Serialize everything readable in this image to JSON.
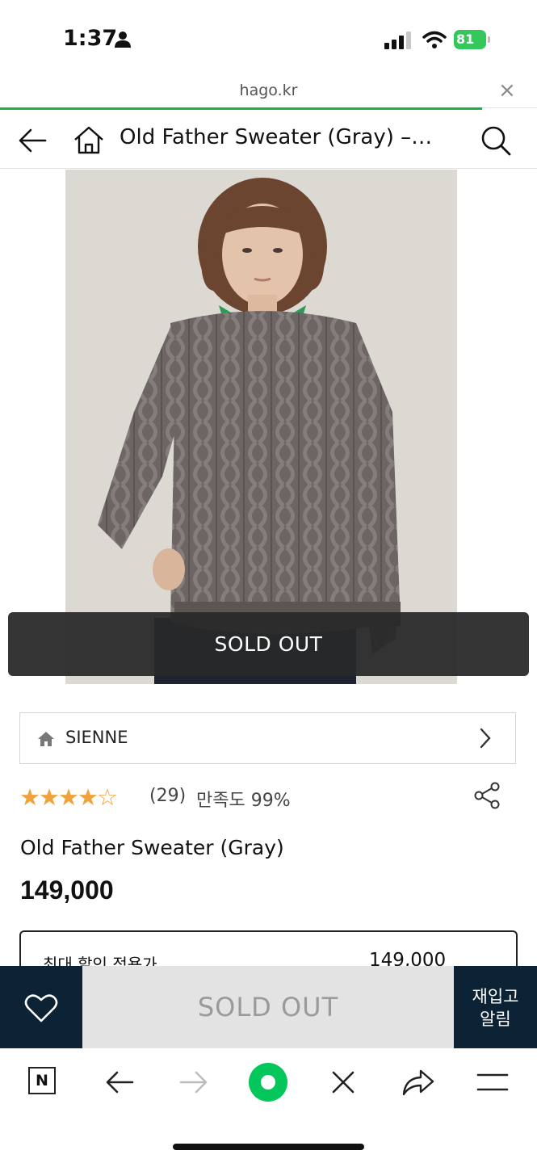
{
  "status_bar": {
    "time": "1:37",
    "battery": "81"
  },
  "browser": {
    "url": "hago.kr",
    "close": "×"
  },
  "nav": {
    "title": "Old Father Sweater (Gray) –…"
  },
  "product": {
    "sold_out_overlay": "SOLD OUT",
    "brand": "SIENNE",
    "rating_stars": "★★★★☆",
    "review_count": "(29)",
    "satisfaction": "만족도 99%",
    "title": "Old Father Sweater (Gray)",
    "price": "149,000",
    "discount_label": "최대 할인 적용가",
    "discount_value": "149,000"
  },
  "action_bar": {
    "sold_out_label": "SOLD OUT",
    "restock_line1": "재입고",
    "restock_line2": "알림"
  },
  "toolbar": {
    "naver_label": "N"
  },
  "colors": {
    "accent_green": "#1fae4b",
    "navy": "#0c2235",
    "star": "#f0a23c",
    "naver_green": "#03c75a"
  }
}
